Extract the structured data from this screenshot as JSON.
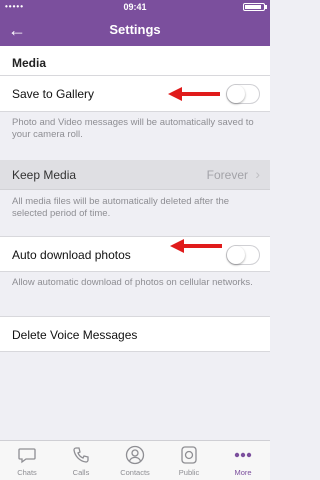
{
  "status_bar": {
    "carrier": "•••••",
    "time": "09:41"
  },
  "nav": {
    "back_glyph": "←",
    "title": "Settings"
  },
  "media_section": {
    "header": "Media"
  },
  "save_to_gallery": {
    "label": "Save to Gallery",
    "enabled": false,
    "description": "Photo and Video messages will be automatically saved to your camera roll."
  },
  "keep_media": {
    "label": "Keep Media",
    "value": "Forever",
    "description": "All media files will be automatically deleted after the selected period of time."
  },
  "auto_download": {
    "label": "Auto download photos",
    "enabled": false,
    "description": "Allow automatic download of photos on cellular networks."
  },
  "delete_voice": {
    "label": "Delete Voice Messages"
  },
  "annotation_color": "#e01b1b",
  "accent_color": "#7b4f9d",
  "tabs": [
    {
      "label": "Chats",
      "icon": "chat-icon"
    },
    {
      "label": "Calls",
      "icon": "phone-icon"
    },
    {
      "label": "Contacts",
      "icon": "contact-icon"
    },
    {
      "label": "Public",
      "icon": "public-icon"
    },
    {
      "label": "More",
      "icon": "more-icon",
      "active": true
    }
  ]
}
